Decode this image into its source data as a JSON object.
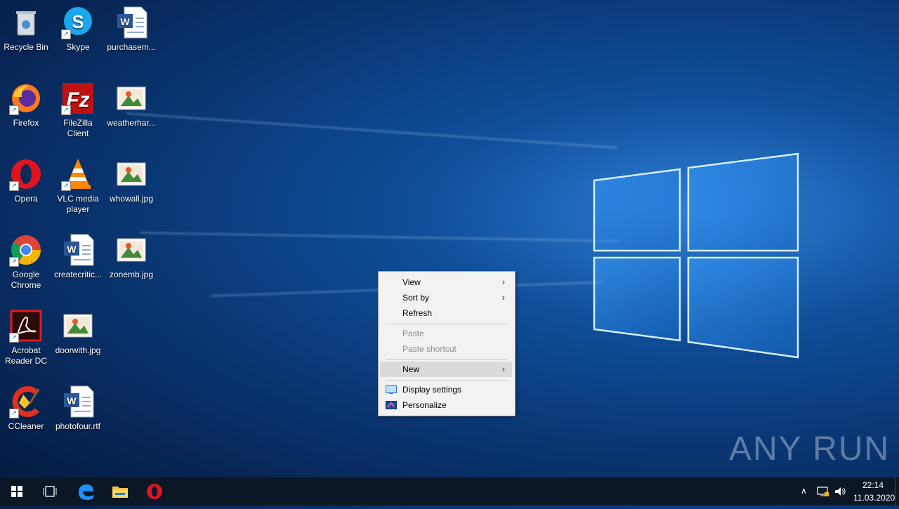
{
  "desktop": {
    "icons": [
      {
        "label": "Recycle Bin",
        "icon": "recycle-bin-icon"
      },
      {
        "label": "Skype",
        "icon": "skype-icon"
      },
      {
        "label": "purchasem...",
        "icon": "word-document-icon"
      },
      {
        "label": "Firefox",
        "icon": "firefox-icon"
      },
      {
        "label": "FileZilla Client",
        "icon": "filezilla-icon"
      },
      {
        "label": "weatherhar...",
        "icon": "image-file-icon"
      },
      {
        "label": "Opera",
        "icon": "opera-icon"
      },
      {
        "label": "VLC media player",
        "icon": "vlc-icon"
      },
      {
        "label": "whowall.jpg",
        "icon": "image-file-icon"
      },
      {
        "label": "Google Chrome",
        "icon": "chrome-icon"
      },
      {
        "label": "createcritic...",
        "icon": "word-document-icon"
      },
      {
        "label": "zonemb.jpg",
        "icon": "image-file-icon"
      },
      {
        "label": "Acrobat Reader DC",
        "icon": "acrobat-icon"
      },
      {
        "label": "doorwith.jpg",
        "icon": "image-file-icon"
      },
      {
        "label": "CCleaner",
        "icon": "ccleaner-icon"
      },
      {
        "label": "photofour.rtf",
        "icon": "word-document-icon"
      }
    ]
  },
  "context_menu": {
    "view": "View",
    "sort_by": "Sort by",
    "refresh": "Refresh",
    "paste": "Paste",
    "paste_shortcut": "Paste shortcut",
    "new": "New",
    "display_settings": "Display settings",
    "personalize": "Personalize"
  },
  "taskbar": {
    "time": "22:14",
    "date": "11.03.2020",
    "pinned": [
      "start-icon",
      "task-view-icon",
      "edge-icon",
      "file-explorer-icon",
      "opera-icon"
    ]
  },
  "watermark": {
    "text": "ANY RUN"
  },
  "colors": {
    "accent": "#0078d7",
    "taskbar": "#0c1725"
  }
}
